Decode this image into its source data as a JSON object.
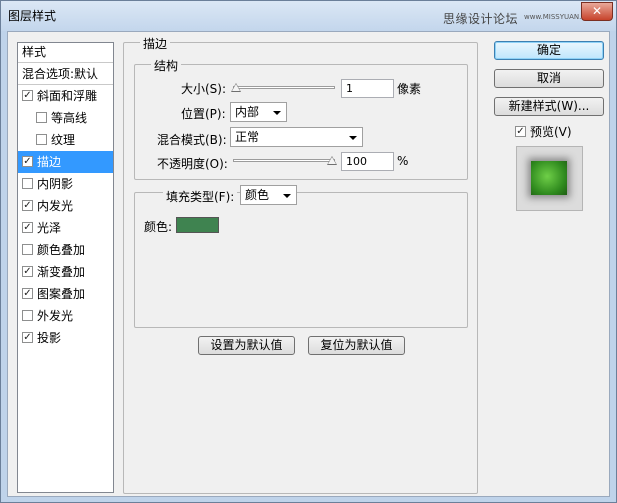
{
  "window": {
    "title": "图层样式",
    "watermark": "思缘设计论坛",
    "watermark_url": "www.MISSYUAN.COM",
    "close_glyph": "✕"
  },
  "style_list": {
    "header": "样式",
    "blend_options": "混合选项:默认",
    "items": [
      {
        "label": "斜面和浮雕",
        "checked": true,
        "indent": false,
        "selected": false
      },
      {
        "label": "等高线",
        "checked": false,
        "indent": true,
        "selected": false
      },
      {
        "label": "纹理",
        "checked": false,
        "indent": true,
        "selected": false
      },
      {
        "label": "描边",
        "checked": true,
        "indent": false,
        "selected": true
      },
      {
        "label": "内阴影",
        "checked": false,
        "indent": false,
        "selected": false
      },
      {
        "label": "内发光",
        "checked": true,
        "indent": false,
        "selected": false
      },
      {
        "label": "光泽",
        "checked": true,
        "indent": false,
        "selected": false
      },
      {
        "label": "颜色叠加",
        "checked": false,
        "indent": false,
        "selected": false
      },
      {
        "label": "渐变叠加",
        "checked": true,
        "indent": false,
        "selected": false
      },
      {
        "label": "图案叠加",
        "checked": true,
        "indent": false,
        "selected": false
      },
      {
        "label": "外发光",
        "checked": false,
        "indent": false,
        "selected": false
      },
      {
        "label": "投影",
        "checked": true,
        "indent": false,
        "selected": false
      }
    ]
  },
  "stroke": {
    "title": "描边",
    "structure_title": "结构",
    "size_label": "大小(S):",
    "size_value": "1",
    "size_unit": "像素",
    "size_fraction": 0.0,
    "position_label": "位置(P):",
    "position_value": "内部",
    "blend_label": "混合模式(B):",
    "blend_value": "正常",
    "opacity_label": "不透明度(O):",
    "opacity_value": "100",
    "opacity_unit": "%",
    "opacity_fraction": 1.0,
    "fill_type_label": "填充类型(F):",
    "fill_type_value": "颜色",
    "color_label": "颜色:",
    "color_hex": "#3f8350"
  },
  "buttons": {
    "make_default": "设置为默认值",
    "reset_default": "复位为默认值",
    "ok": "确定",
    "cancel": "取消",
    "new_style": "新建样式(W)...",
    "preview_label": "预览(V)",
    "preview_checked": true
  },
  "colors": {
    "selection": "#3399ff",
    "titlebar": "#c3d6ec",
    "check_glyph": "✓"
  }
}
